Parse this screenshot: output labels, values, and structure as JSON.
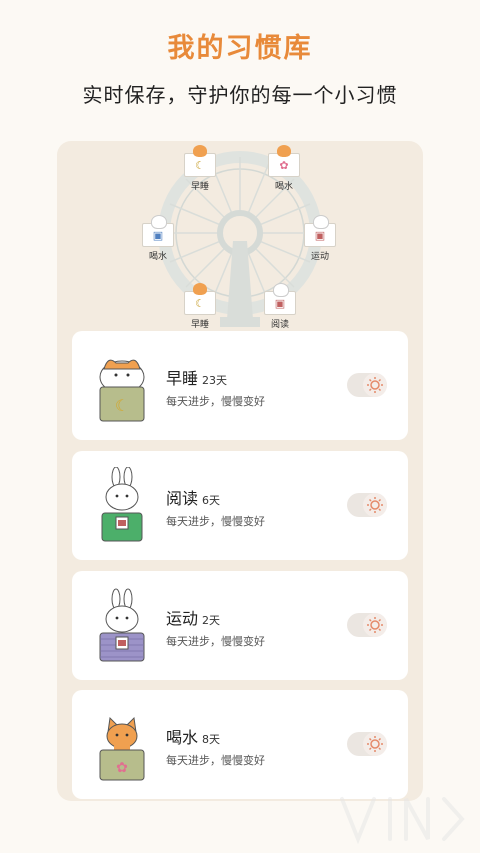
{
  "header": {
    "title": "我的习惯库",
    "subtitle": "实时保存，守护你的每一个小习惯"
  },
  "wheel": {
    "cabins": [
      {
        "label": "早睡",
        "icon": "moon-icon",
        "animal": "cat-icon",
        "color": "#f0a050"
      },
      {
        "label": "喝水",
        "icon": "flower-icon",
        "animal": "cat-icon",
        "color": "#f0a050"
      },
      {
        "label": "运动",
        "icon": "badge-icon",
        "animal": "rabbit-icon",
        "color": "#f4e8e8"
      },
      {
        "label": "阅读",
        "icon": "badge-icon",
        "animal": "rabbit-icon",
        "color": "#f4e8e8"
      },
      {
        "label": "早睡",
        "icon": "moon-icon",
        "animal": "cat-icon",
        "color": "#f0a050"
      },
      {
        "label": "喝水",
        "icon": "badge-icon",
        "animal": "rabbit-icon",
        "color": "#f4e8e8"
      }
    ]
  },
  "habits": [
    {
      "name": "早睡",
      "days": "23天",
      "desc": "每天进步，慢慢变好",
      "animal": "cat-icon",
      "pot_color": "#b7bd8c",
      "pot_icon": "moon-icon"
    },
    {
      "name": "阅读",
      "days": "6天",
      "desc": "每天进步，慢慢变好",
      "animal": "rabbit-icon",
      "pot_color": "#4caf6a",
      "pot_icon": "badge-icon"
    },
    {
      "name": "运动",
      "days": "2天",
      "desc": "每天进步，慢慢变好",
      "animal": "rabbit-icon",
      "pot_color": "#9c93c8",
      "pot_icon": "badge-icon"
    },
    {
      "name": "喝水",
      "days": "8天",
      "desc": "每天进步，慢慢变好",
      "animal": "cat-icon",
      "pot_color": "#b7bd8c",
      "pot_icon": "flower-icon"
    }
  ],
  "colors": {
    "accent": "#e88a3a",
    "panel": "#f3ebe0",
    "toggle_icon": "#e58a6a"
  }
}
